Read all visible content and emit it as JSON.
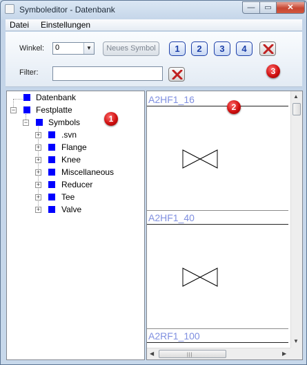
{
  "window": {
    "title": "Symboleditor - Datenbank",
    "minimize_glyph": "—",
    "maximize_glyph": "▭",
    "close_glyph": "✕"
  },
  "menu": {
    "items": [
      "Datei",
      "Einstellungen"
    ]
  },
  "toolbar": {
    "angle_label": "Winkel:",
    "angle_value": "0",
    "new_symbol_label": "Neues Symbol",
    "number_buttons": [
      "1",
      "2",
      "3",
      "4"
    ],
    "filter_label": "Filter:",
    "filter_value": ""
  },
  "badges": [
    "1",
    "2",
    "3"
  ],
  "tree": {
    "nodes": [
      {
        "label": "Datenbank",
        "level": 0,
        "expander": ""
      },
      {
        "label": "Festplatte",
        "level": 0,
        "expander": "−"
      },
      {
        "label": "Symbols",
        "level": 1,
        "expander": "−"
      },
      {
        "label": ".svn",
        "level": 2,
        "expander": "+"
      },
      {
        "label": "Flange",
        "level": 2,
        "expander": "+"
      },
      {
        "label": "Knee",
        "level": 2,
        "expander": "+"
      },
      {
        "label": "Miscellaneous",
        "level": 2,
        "expander": "+"
      },
      {
        "label": "Reducer",
        "level": 2,
        "expander": "+"
      },
      {
        "label": "Tee",
        "level": 2,
        "expander": "+"
      },
      {
        "label": "Valve",
        "level": 2,
        "expander": "+"
      }
    ]
  },
  "symbols": [
    {
      "name": "A2HF1_16",
      "shape": "valve-icon"
    },
    {
      "name": "A2HF1_40",
      "shape": "valve-icon"
    },
    {
      "name": "A2RF1_100",
      "shape": ""
    }
  ],
  "scrollbars": {
    "up": "▲",
    "down": "▼",
    "left": "◀",
    "right": "▶",
    "grip": "|||"
  },
  "colors": {
    "folder_icon": "#0000ff",
    "symbol_title": "#7f8fe0",
    "number_buttons": "#1b3ea8",
    "badge": "#d01010",
    "clear_x": "#c02020"
  }
}
